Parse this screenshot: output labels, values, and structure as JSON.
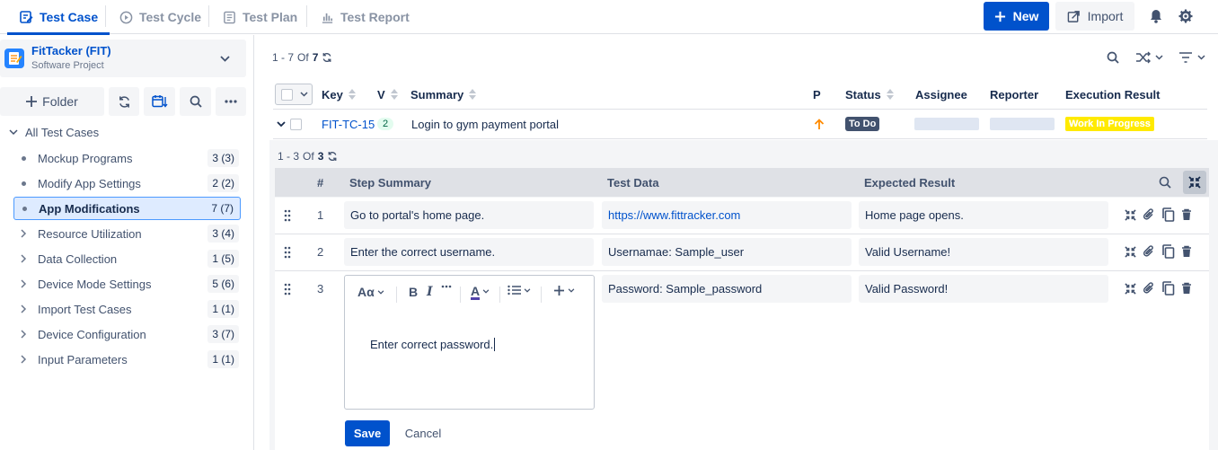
{
  "tabs": [
    {
      "label": "Test Case",
      "icon": "edit-doc-icon",
      "active": true
    },
    {
      "label": "Test Cycle",
      "icon": "play-circle-icon"
    },
    {
      "label": "Test Plan",
      "icon": "list-doc-icon"
    },
    {
      "label": "Test Report",
      "icon": "bar-chart-icon"
    }
  ],
  "header": {
    "new_label": "New",
    "import_label": "Import"
  },
  "project": {
    "name": "FitTacker (FIT)",
    "type": "Software Project"
  },
  "sidebar": {
    "folder_label": "Folder",
    "root_label": "All Test Cases",
    "items": [
      {
        "label": "Mockup Programs",
        "count": "3 (3)",
        "lead": "dot"
      },
      {
        "label": "Modify App Settings",
        "count": "2 (2)",
        "lead": "dot"
      },
      {
        "label": "App Modifications",
        "count": "7 (7)",
        "lead": "dot",
        "selected": true
      },
      {
        "label": "Resource Utilization",
        "count": "3 (4)",
        "lead": "chevron"
      },
      {
        "label": "Data Collection",
        "count": "1 (5)",
        "lead": "chevron"
      },
      {
        "label": "Device Mode Settings",
        "count": "5 (6)",
        "lead": "chevron"
      },
      {
        "label": "Import Test Cases",
        "count": "1 (1)",
        "lead": "chevron"
      },
      {
        "label": "Device Configuration",
        "count": "3 (7)",
        "lead": "chevron"
      },
      {
        "label": "Input Parameters",
        "count": "1 (1)",
        "lead": "chevron"
      }
    ]
  },
  "list": {
    "pager": {
      "range": "1 - 7",
      "of": "Of",
      "total": "7"
    },
    "columns": {
      "key": "Key",
      "v": "V",
      "summary": "Summary",
      "p": "P",
      "status": "Status",
      "assignee": "Assignee",
      "reporter": "Reporter",
      "execution": "Execution Result"
    },
    "row": {
      "key": "FIT-TC-15",
      "version": "2",
      "summary": "Login to gym payment portal",
      "status": "To Do",
      "execution": "Work In Progress"
    }
  },
  "steps": {
    "pager": {
      "range": "1 - 3",
      "of": "Of",
      "total": "3"
    },
    "columns": {
      "num": "#",
      "summary": "Step Summary",
      "data": "Test Data",
      "expected": "Expected Result"
    },
    "rows": [
      {
        "num": "1",
        "summary": "Go to portal's home page.",
        "data": "https://www.fittracker.com",
        "expected": "Home page opens."
      },
      {
        "num": "2",
        "summary": "Enter the correct username.",
        "data": "Usernamae: Sample_user",
        "expected": "Valid Username!"
      },
      {
        "num": "3",
        "summary": "Enter correct password.",
        "data": "Password: Sample_password",
        "expected": "Valid Password!"
      }
    ],
    "editor": {
      "font_label": "Aα",
      "text": "Enter correct password."
    },
    "save_label": "Save",
    "cancel_label": "Cancel"
  },
  "colors": {
    "accent": "#0052cc",
    "todo": "#42526e",
    "wip": "#ffea00",
    "priority_high": "#ff8b00"
  }
}
